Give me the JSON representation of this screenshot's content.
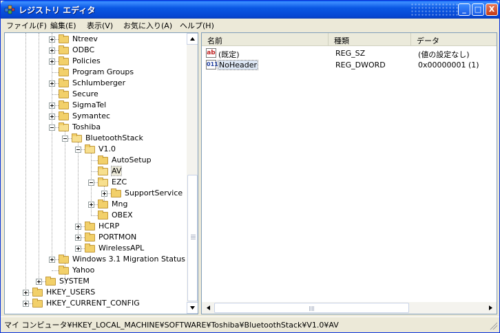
{
  "window": {
    "title": "レジストリ エディタ",
    "controls": {
      "minimize": "_",
      "maximize": "□",
      "close": "X"
    }
  },
  "menubar": [
    "ファイル(F)",
    "編集(E)",
    "表示(V)",
    "お気に入り(A)",
    "ヘルプ(H)"
  ],
  "tree": [
    {
      "label": "Ntreev",
      "expander": "plus",
      "open": false,
      "selected": false
    },
    {
      "label": "ODBC",
      "expander": "plus",
      "open": false,
      "selected": false
    },
    {
      "label": "Policies",
      "expander": "plus",
      "open": false,
      "selected": false
    },
    {
      "label": "Program Groups",
      "expander": "none",
      "open": false,
      "selected": false
    },
    {
      "label": "Schlumberger",
      "expander": "plus",
      "open": false,
      "selected": false
    },
    {
      "label": "Secure",
      "expander": "none",
      "open": false,
      "selected": false
    },
    {
      "label": "SigmaTel",
      "expander": "plus",
      "open": false,
      "selected": false
    },
    {
      "label": "Symantec",
      "expander": "plus",
      "open": false,
      "selected": false
    },
    {
      "label": "Toshiba",
      "expander": "minus",
      "open": true,
      "selected": false
    },
    {
      "label": "BluetoothStack",
      "expander": "minus",
      "open": true,
      "selected": false
    },
    {
      "label": "V1.0",
      "expander": "minus",
      "open": true,
      "selected": false
    },
    {
      "label": "AutoSetup",
      "expander": "none",
      "open": false,
      "selected": false
    },
    {
      "label": "AV",
      "expander": "none",
      "open": true,
      "selected": true
    },
    {
      "label": "EZC",
      "expander": "minus",
      "open": true,
      "selected": false
    },
    {
      "label": "SupportService",
      "expander": "plus",
      "open": false,
      "selected": false
    },
    {
      "label": "Mng",
      "expander": "plus",
      "open": false,
      "selected": false
    },
    {
      "label": "OBEX",
      "expander": "none",
      "open": false,
      "selected": false
    },
    {
      "label": "HCRP",
      "expander": "plus",
      "open": false,
      "selected": false
    },
    {
      "label": "PORTMON",
      "expander": "plus",
      "open": false,
      "selected": false
    },
    {
      "label": "WirelessAPL",
      "expander": "plus",
      "open": false,
      "selected": false
    },
    {
      "label": "Windows 3.1 Migration Status",
      "expander": "plus",
      "open": false,
      "selected": false
    },
    {
      "label": "Yahoo",
      "expander": "none",
      "open": false,
      "selected": false
    },
    {
      "label": "SYSTEM",
      "expander": "plus",
      "open": false,
      "selected": false
    },
    {
      "label": "HKEY_USERS",
      "expander": "plus",
      "open": false,
      "selected": false
    },
    {
      "label": "HKEY_CURRENT_CONFIG",
      "expander": "plus",
      "open": false,
      "selected": false
    }
  ],
  "list": {
    "columns": [
      "名前",
      "種類",
      "データ"
    ],
    "rows": [
      {
        "icon": "string-value-icon",
        "icon_text": "ab",
        "name": "(既定)",
        "type": "REG_SZ",
        "data": "(値の設定なし)",
        "selected": false
      },
      {
        "icon": "dword-value-icon",
        "icon_text": "011",
        "name": "NoHeader",
        "type": "REG_DWORD",
        "data": "0x00000001 (1)",
        "selected": true
      }
    ]
  },
  "status": {
    "path": "マイ コンピュータ¥HKEY_LOCAL_MACHINE¥SOFTWARE¥Toshiba¥BluetoothStack¥V1.0¥AV"
  },
  "colors": {
    "titlebar": "#0A58E4",
    "window_bg": "#ECE9D8",
    "folder": "#F2D06A"
  }
}
